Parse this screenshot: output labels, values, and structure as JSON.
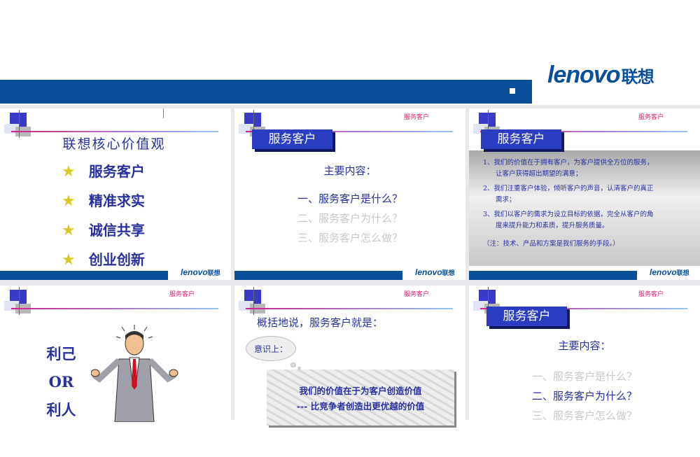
{
  "brand": {
    "logo_text": "lenovo",
    "logo_cn": "联想",
    "color": "#0a4f9a"
  },
  "slide_tag": "服务客户",
  "slides": [
    {
      "title": "联想核心价值观",
      "items": [
        "服务客户",
        "精准求实",
        "诚信共享",
        "创业创新"
      ]
    },
    {
      "title": "服务客户",
      "subtitle": "主要内容：",
      "items": [
        "一、服务客户是什么？",
        "二、服务客户为什么？",
        "三、服务客户怎么做？"
      ]
    },
    {
      "title": "服务客户",
      "points": [
        "1、我们的价值在于拥有客户，为客户提供全方位的服务，",
        "让客户获得超出期望的满意；",
        "2、我们注重客户体验，倾听客户的声音，认清客户的真正",
        "需求；",
        "3、我们以客户的需求为设立目标的依据，完全从客户的角",
        "度来提升能力和素质，提升服务质量。"
      ],
      "note": "（注：技术、产品和方案是我们服务的手段。）"
    },
    {
      "lines": [
        "利己",
        "OR",
        "利人"
      ]
    },
    {
      "heading": "概括地说，服务客户就是：",
      "bubble": "意识上：",
      "box_line1": "我们的价值在于为客户创造价值",
      "box_line2": "--- 比竞争者创造出更优越的价值"
    },
    {
      "title": "服务客户",
      "subtitle": "主要内容：",
      "items": [
        "一、服务客户是什么？",
        "二、服务客户为什么？",
        "三、服务客户怎么做？"
      ]
    }
  ]
}
